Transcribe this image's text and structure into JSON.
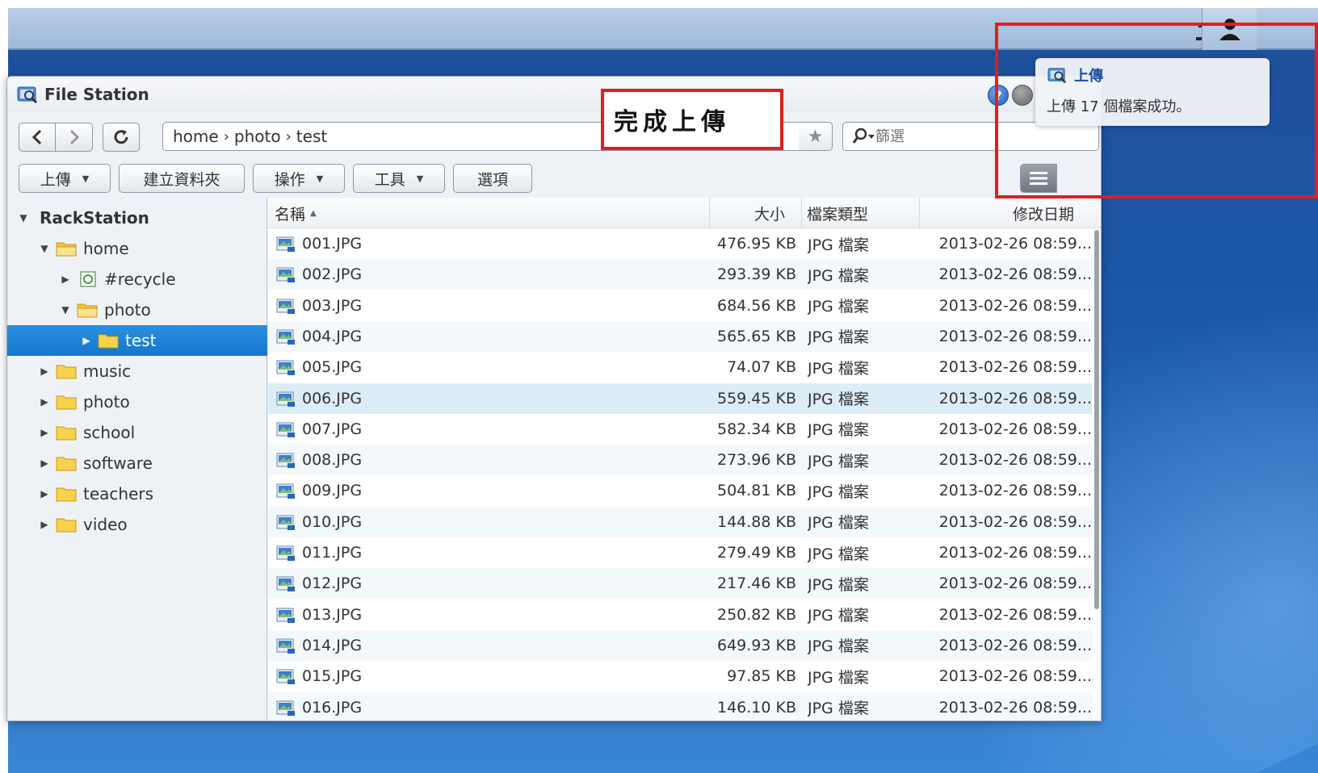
{
  "window": {
    "title": "File Station"
  },
  "nav": {
    "breadcrumb": [
      "home",
      "photo",
      "test"
    ],
    "search_placeholder": "篩選"
  },
  "toolbar": {
    "upload": "上傳",
    "new_folder": "建立資料夾",
    "action": "操作",
    "tools": "工具",
    "settings": "選項"
  },
  "sidebar": {
    "root": "RackStation",
    "items": [
      {
        "label": "home"
      },
      {
        "label": "#recycle"
      },
      {
        "label": "photo"
      },
      {
        "label": "test"
      },
      {
        "label": "music"
      },
      {
        "label": "photo"
      },
      {
        "label": "school"
      },
      {
        "label": "software"
      },
      {
        "label": "teachers"
      },
      {
        "label": "video"
      }
    ]
  },
  "grid": {
    "columns": {
      "name": "名稱",
      "size": "大小",
      "type": "檔案類型",
      "modified": "修改日期"
    },
    "rows": [
      {
        "name": "001.JPG",
        "size": "476.95 KB",
        "type": "JPG 檔案",
        "modified": "2013-02-26 08:59..."
      },
      {
        "name": "002.JPG",
        "size": "293.39 KB",
        "type": "JPG 檔案",
        "modified": "2013-02-26 08:59..."
      },
      {
        "name": "003.JPG",
        "size": "684.56 KB",
        "type": "JPG 檔案",
        "modified": "2013-02-26 08:59..."
      },
      {
        "name": "004.JPG",
        "size": "565.65 KB",
        "type": "JPG 檔案",
        "modified": "2013-02-26 08:59..."
      },
      {
        "name": "005.JPG",
        "size": "74.07 KB",
        "type": "JPG 檔案",
        "modified": "2013-02-26 08:59..."
      },
      {
        "name": "006.JPG",
        "size": "559.45 KB",
        "type": "JPG 檔案",
        "modified": "2013-02-26 08:59..."
      },
      {
        "name": "007.JPG",
        "size": "582.34 KB",
        "type": "JPG 檔案",
        "modified": "2013-02-26 08:59..."
      },
      {
        "name": "008.JPG",
        "size": "273.96 KB",
        "type": "JPG 檔案",
        "modified": "2013-02-26 08:59..."
      },
      {
        "name": "009.JPG",
        "size": "504.81 KB",
        "type": "JPG 檔案",
        "modified": "2013-02-26 08:59..."
      },
      {
        "name": "010.JPG",
        "size": "144.88 KB",
        "type": "JPG 檔案",
        "modified": "2013-02-26 08:59..."
      },
      {
        "name": "011.JPG",
        "size": "279.49 KB",
        "type": "JPG 檔案",
        "modified": "2013-02-26 08:59..."
      },
      {
        "name": "012.JPG",
        "size": "217.46 KB",
        "type": "JPG 檔案",
        "modified": "2013-02-26 08:59..."
      },
      {
        "name": "013.JPG",
        "size": "250.82 KB",
        "type": "JPG 檔案",
        "modified": "2013-02-26 08:59..."
      },
      {
        "name": "014.JPG",
        "size": "649.93 KB",
        "type": "JPG 檔案",
        "modified": "2013-02-26 08:59..."
      },
      {
        "name": "015.JPG",
        "size": "97.85 KB",
        "type": "JPG 檔案",
        "modified": "2013-02-26 08:59..."
      },
      {
        "name": "016.JPG",
        "size": "146.10 KB",
        "type": "JPG 檔案",
        "modified": "2013-02-26 08:59..."
      }
    ]
  },
  "callout": {
    "text": "完成上傳"
  },
  "notification": {
    "title": "上傳",
    "message": "上傳 17 個檔案成功。"
  },
  "colors": {
    "accent": "#1677cc",
    "annotation": "#e0201b",
    "desktop": "#1c58a8"
  },
  "icons": [
    "upload-icon",
    "user-icon",
    "file-station-icon",
    "back-icon",
    "forward-icon",
    "refresh-icon",
    "star-icon",
    "search-icon",
    "list-view-icon",
    "grid-view-icon",
    "folder-icon",
    "recycle-icon",
    "image-file-icon",
    "help-icon"
  ]
}
